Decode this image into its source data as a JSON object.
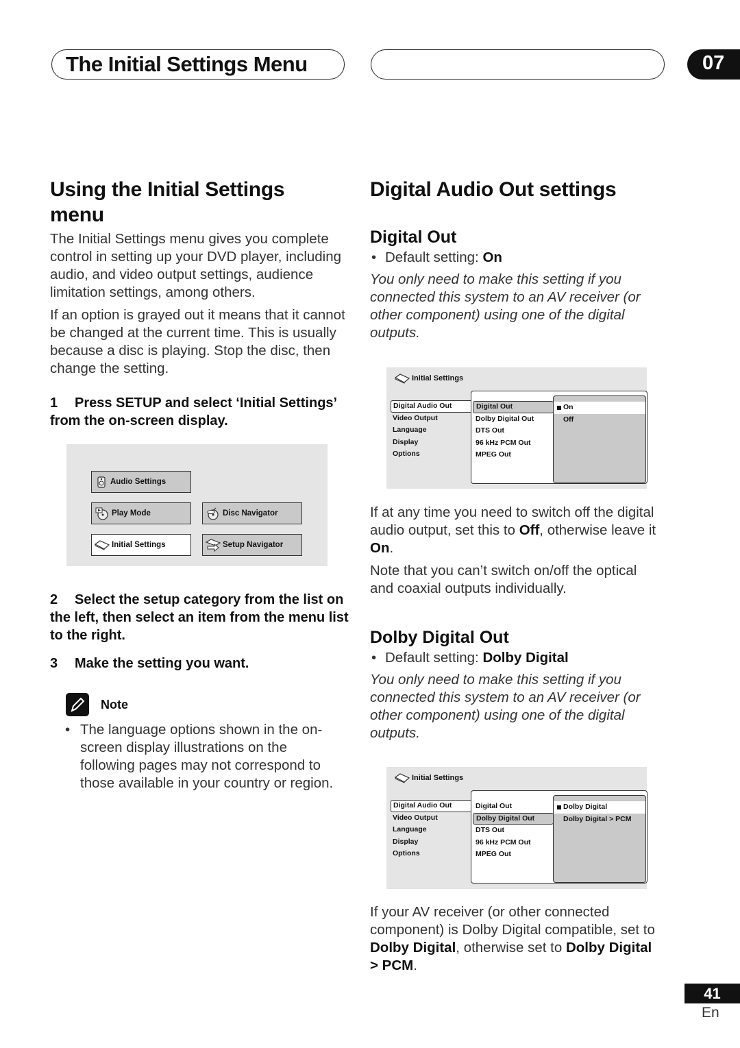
{
  "header": {
    "title": "The Initial Settings Menu",
    "chapter": "07"
  },
  "left": {
    "heading": "Using the Initial Settings menu",
    "para1": "The Initial Settings menu gives you complete control in setting up your DVD player, including audio, and video output settings, audience limitation settings, among others.",
    "para2": "If an option is grayed out it means that it cannot be changed at the current time. This is usually because a disc is playing. Stop the disc, then change the setting.",
    "step1": {
      "num": "1",
      "text": "Press SETUP and select ‘Initial Settings’ from the on-screen display."
    },
    "setup_menu": {
      "buttons": [
        {
          "label": "Audio Settings",
          "icon": "speaker-icon",
          "selected": false
        },
        {
          "label": "Play Mode",
          "icon": "play-mode-disc-icon",
          "selected": false
        },
        {
          "label": "Disc Navigator",
          "icon": "disc-navigator-icon",
          "selected": false
        },
        {
          "label": "Initial Settings",
          "icon": "settings-box-icon",
          "selected": true
        },
        {
          "label": "Setup Navigator",
          "icon": "setup-navigator-icon",
          "selected": false
        }
      ]
    },
    "step2": {
      "num": "2",
      "text": "Select the setup category from the list on the left, then select an item from the menu list to the right."
    },
    "step3": {
      "num": "3",
      "text": "Make the setting you want."
    },
    "note": {
      "label": "Note",
      "bullet": "The language options shown in the on-screen display illustrations on the following pages may not correspond to those available in your country or region."
    }
  },
  "right": {
    "heading": "Digital Audio Out settings",
    "digital_out": {
      "heading": "Digital Out",
      "default_label": "Default setting: ",
      "default_value": "On",
      "intro": "You only need to make this setting if you connected this system to an AV receiver (or other component) using one of the digital outputs.",
      "screen": {
        "title": "Initial Settings",
        "categories": [
          "Digital Audio Out",
          "Video Output",
          "Language",
          "Display",
          "Options"
        ],
        "selected_category": 0,
        "items": [
          "Digital Out",
          "Dolby Digital Out",
          "DTS Out",
          "96 kHz PCM Out",
          "MPEG Out"
        ],
        "selected_item": 0,
        "options": [
          "On",
          "Off"
        ],
        "selected_option": 0
      },
      "para1_a": "If at any time you need to switch off the digital audio output, set this to ",
      "para1_b": "Off",
      "para1_c": ", otherwise leave it ",
      "para1_d": "On",
      "para1_e": ".",
      "para2": "Note that you can’t switch on/off the optical and coaxial outputs individually."
    },
    "dolby_out": {
      "heading": "Dolby Digital Out",
      "default_label": "Default setting: ",
      "default_value": "Dolby Digital",
      "intro": "You only need to make this setting if you connected this system to an AV receiver (or other component) using one of the digital outputs.",
      "screen": {
        "title": "Initial Settings",
        "categories": [
          "Digital Audio Out",
          "Video Output",
          "Language",
          "Display",
          "Options"
        ],
        "selected_category": 0,
        "items": [
          "Digital Out",
          "Dolby Digital Out",
          "DTS Out",
          "96 kHz PCM Out",
          "MPEG Out"
        ],
        "selected_item": 1,
        "options": [
          "Dolby Digital",
          "Dolby Digital > PCM"
        ],
        "selected_option": 0
      },
      "para_a": "If your AV receiver (or other connected component) is Dolby Digital compatible, set to ",
      "para_b": "Dolby Digital",
      "para_c": ", otherwise set to ",
      "para_d": "Dolby Digital > PCM",
      "para_e": "."
    }
  },
  "footer": {
    "page_number": "41",
    "language": "En"
  }
}
